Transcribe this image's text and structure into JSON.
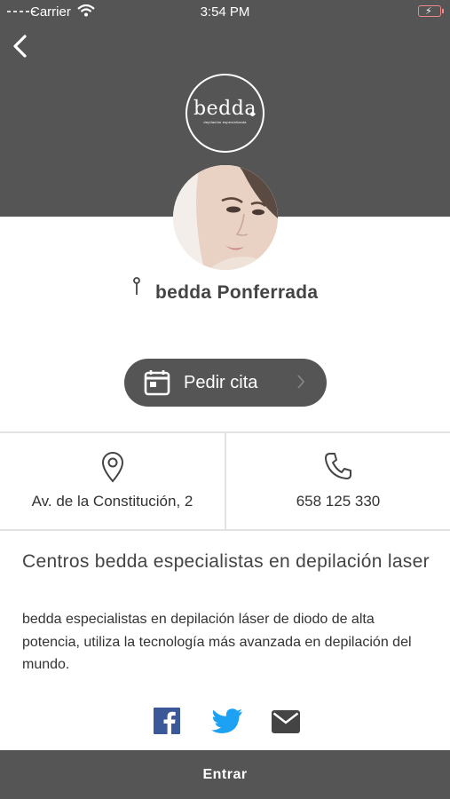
{
  "status_bar": {
    "carrier": "Carrier",
    "time": "3:54 PM"
  },
  "header": {
    "logo_wordmark": "bedda",
    "logo_tagline": "depilación especializada",
    "header_color": "#555555"
  },
  "profile": {
    "center_name": "bedda Ponferrada"
  },
  "cta": {
    "label": "Pedir cita"
  },
  "contact": {
    "address": "Av. de la Constitución, 2",
    "phone": "658 125 330"
  },
  "description": {
    "title": "Centros bedda especialistas en depilación laser",
    "body": "bedda especialistas en depilación láser de diodo de alta potencia, utiliza la tecnología más avanzada en depilación del mundo."
  },
  "social": {
    "icons": [
      "facebook-icon",
      "twitter-icon",
      "email-icon"
    ],
    "facebook_color": "#3b5998",
    "twitter_color": "#1da1f2"
  },
  "footer": {
    "label": "Entrar"
  }
}
